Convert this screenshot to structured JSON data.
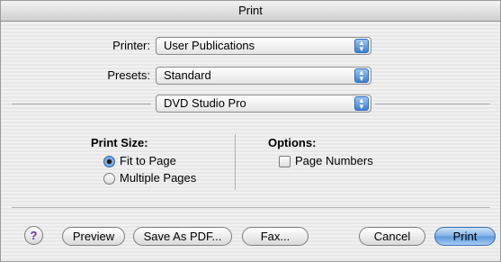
{
  "window": {
    "title": "Print"
  },
  "printer": {
    "label": "Printer:",
    "value": "User Publications"
  },
  "presets": {
    "label": "Presets:",
    "value": "Standard"
  },
  "pane": {
    "value": "DVD Studio Pro"
  },
  "print_size": {
    "heading": "Print Size:",
    "options": [
      {
        "label": "Fit to Page",
        "selected": true
      },
      {
        "label": "Multiple Pages",
        "selected": false
      }
    ]
  },
  "options": {
    "heading": "Options:",
    "page_numbers": {
      "label": "Page Numbers",
      "checked": false
    }
  },
  "buttons": {
    "help": "?",
    "preview": "Preview",
    "save_pdf": "Save As PDF...",
    "fax": "Fax...",
    "cancel": "Cancel",
    "print": "Print"
  },
  "icons": {
    "popup_arrow": "up-down-arrows-icon"
  }
}
